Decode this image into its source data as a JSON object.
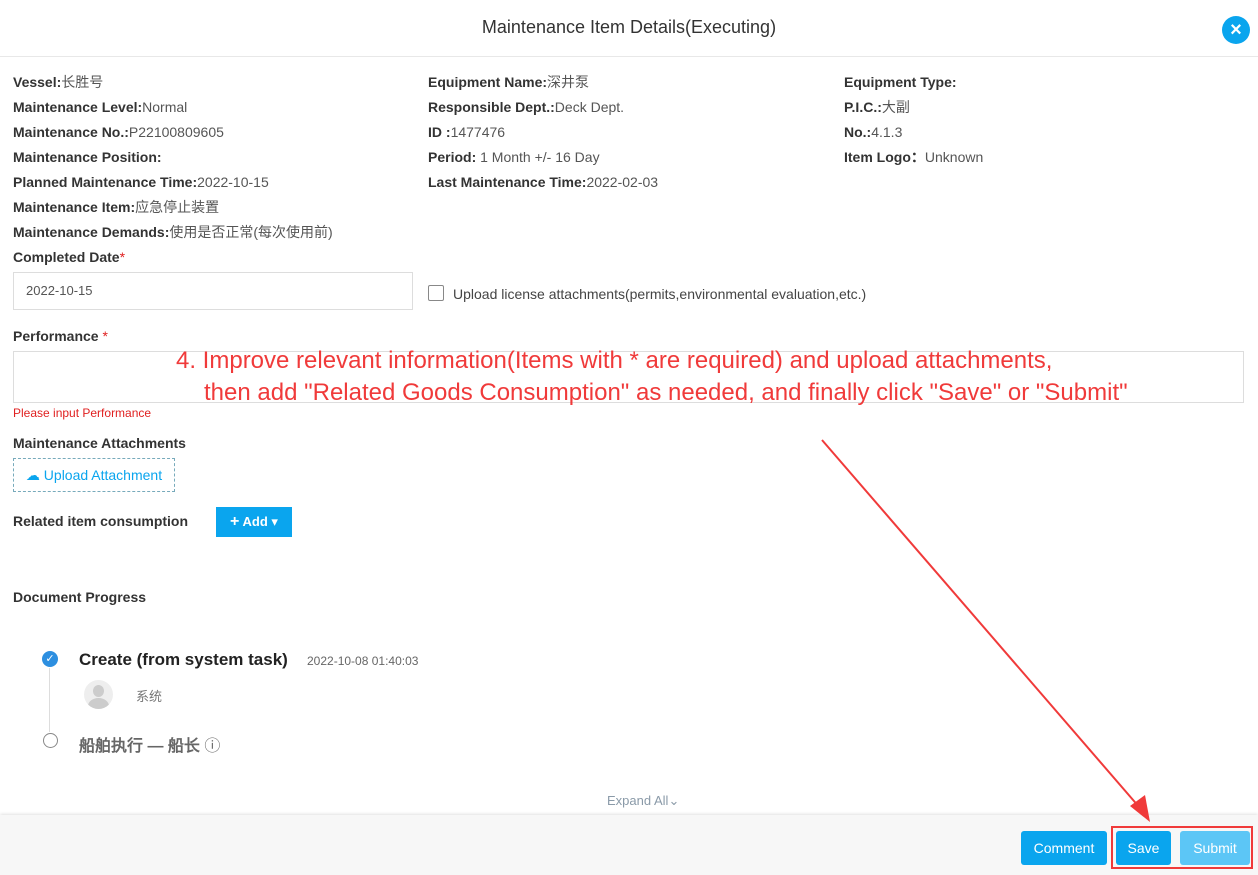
{
  "header": {
    "title": "Maintenance Item Details(Executing)",
    "close_icon": "close-icon"
  },
  "fields": [
    {
      "label": "Vessel:",
      "value": "长胜号"
    },
    {
      "label": "Maintenance Level:",
      "value": "Normal"
    },
    {
      "label": "Maintenance No.:",
      "value": "P22100809605"
    },
    {
      "label": "Maintenance Position:",
      "value": ""
    },
    {
      "label": "Planned Maintenance Time:",
      "value": "2022-10-15"
    },
    {
      "label": "Maintenance Item:",
      "value": "应急停止装置"
    },
    {
      "label": "Maintenance Demands:",
      "value": "使用是否正常(每次使用前)"
    },
    {
      "label": "Equipment Name:",
      "value": "深井泵"
    },
    {
      "label": "Responsible Dept.:",
      "value": "Deck Dept."
    },
    {
      "label": "ID :",
      "value": "1477476"
    },
    {
      "label": "Period:",
      "value": " 1 Month +/- 16 Day"
    },
    {
      "label": "Last Maintenance Time:",
      "value": "2022-02-03"
    },
    {
      "label": "Equipment Type:",
      "value": ""
    },
    {
      "label": "P.I.C.:",
      "value": "大副"
    },
    {
      "label": "No.:",
      "value": "4.1.3"
    },
    {
      "label": "Item Logo：",
      "value": "Unknown"
    }
  ],
  "form": {
    "completed_date_label": "Completed Date",
    "required": "*",
    "completed_date_value": "2022-10-15",
    "upload_license_label": "Upload license attachments(permits,environmental evaluation,etc.)",
    "performance_label": "Performance ",
    "performance_error": "Please input Performance",
    "attachments_label": "Maintenance Attachments",
    "upload_button": "Upload Attachment",
    "related_label": "Related item consumption",
    "add_button": "Add"
  },
  "annotation": {
    "line1": "4. Improve relevant information(Items with * are required) and upload attachments,",
    "line2": "then add \"Related Goods Consumption\" as needed, and finally click \"Save\" or \"Submit\""
  },
  "progress": {
    "title": "Document Progress",
    "steps": [
      {
        "title": "Create (from system task)",
        "time": "2022-10-08 01:40:03",
        "user": "系统",
        "status": "done"
      },
      {
        "title": "船舶执行 — 船长",
        "status": "pending"
      }
    ],
    "info_icon": "ⓘ",
    "expand": "Expand All"
  },
  "footer": {
    "comment": "Comment",
    "save": "Save",
    "submit": "Submit"
  },
  "colors": {
    "accent": "#0aa5ee",
    "annotation": "#f03a3a",
    "submit_disabled": "#5cc6f6"
  }
}
